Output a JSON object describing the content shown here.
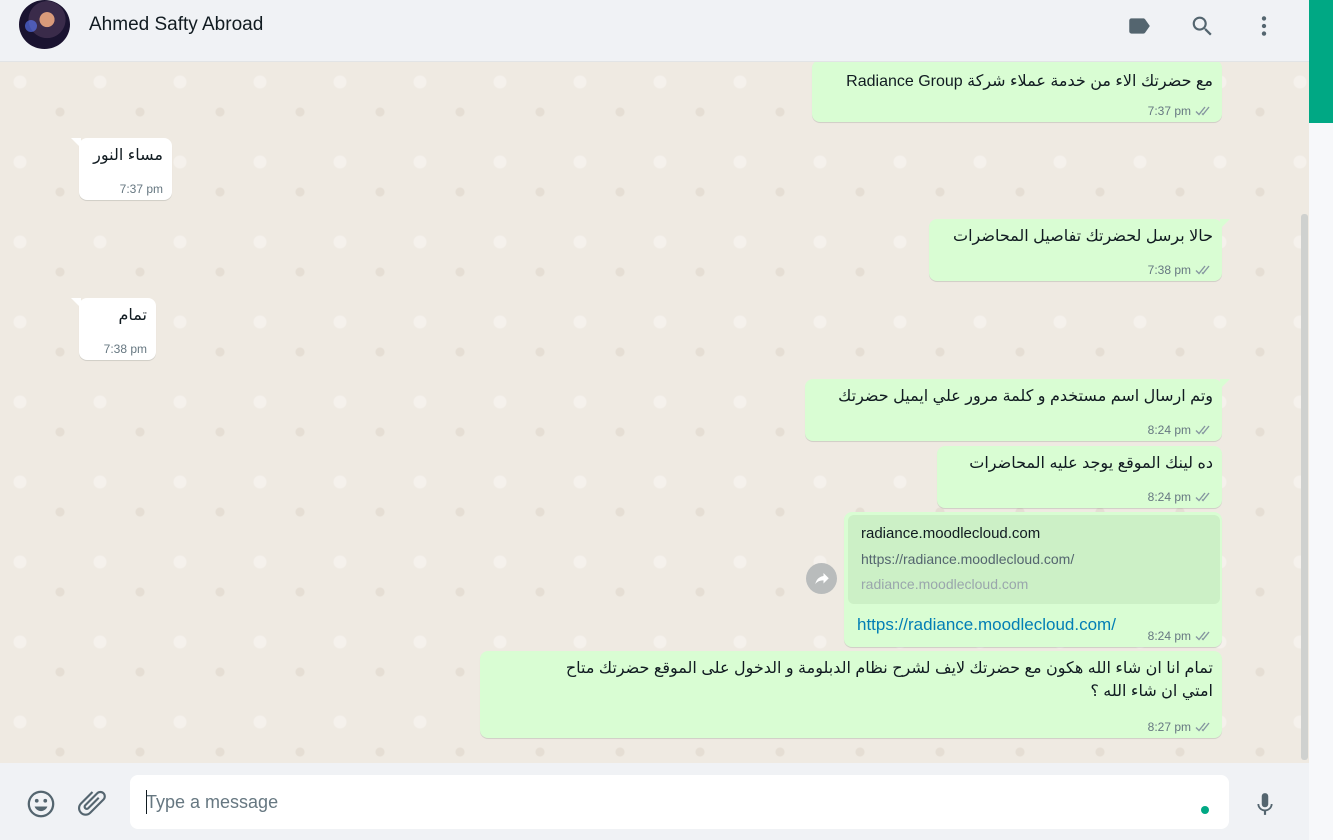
{
  "header": {
    "contact_name": "Ahmed Safty Abroad",
    "icons": [
      "label-icon",
      "search-icon",
      "menu-icon"
    ]
  },
  "messages": [
    {
      "dir": "out",
      "text": "مع حضرتك الاء من خدمة عملاء شركة Radiance Group",
      "time": "7:37 pm"
    },
    {
      "dir": "in",
      "text": "مساء النور",
      "time": "7:37 pm"
    },
    {
      "dir": "out",
      "text": "حالا برسل لحضرتك تفاصيل المحاضرات",
      "time": "7:38 pm"
    },
    {
      "dir": "in",
      "text": "تمام",
      "time": "7:38 pm"
    },
    {
      "dir": "out",
      "text": "وتم ارسال اسم مستخدم و كلمة مرور علي ايميل حضرتك",
      "time": "8:24 pm"
    },
    {
      "dir": "out",
      "text": "ده لينك الموقع يوجد عليه المحاضرات",
      "time": "8:24 pm"
    },
    {
      "dir": "out",
      "type": "link",
      "preview_title": "radiance.moodlecloud.com",
      "preview_desc": "https://radiance.moodlecloud.com/",
      "preview_host": "radiance.moodlecloud.com",
      "link": "https://radiance.moodlecloud.com/",
      "time": "8:24 pm"
    },
    {
      "dir": "out",
      "text_line1": "تمام انا ان شاء الله هكون مع حضرتك لايف لشرح نظام الدبلومة و الدخول على الموقع حضرتك متاح",
      "text_line2": "امتي ان شاء الله ؟",
      "time": "8:27 pm"
    }
  ],
  "footer": {
    "placeholder": "Type a message",
    "icons": [
      "emoji-icon",
      "attach-icon",
      "mic-icon"
    ]
  },
  "colors": {
    "outgoing_bubble": "#d9fdd3",
    "incoming_bubble": "#ffffff",
    "accent": "#00a884",
    "link": "#027eb5",
    "read_ticks": "#8696a0"
  }
}
